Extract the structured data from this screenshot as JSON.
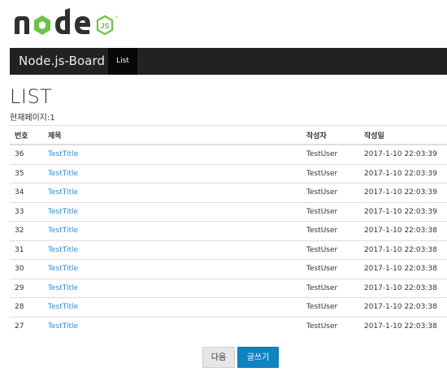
{
  "logo": {
    "text": "node",
    "badge": "JS",
    "label": "node.js"
  },
  "navbar": {
    "brand": "Node.js-Board",
    "items": [
      {
        "label": "List",
        "active": true
      }
    ]
  },
  "page": {
    "title": "LIST",
    "current_page_label": "현재페이지:1"
  },
  "table": {
    "columns": [
      "번호",
      "제목",
      "작성자",
      "작성일"
    ],
    "rows": [
      {
        "num": "36",
        "title": "TestTitle",
        "author": "TestUser",
        "date": "2017-1-10 22:03:39"
      },
      {
        "num": "35",
        "title": "TestTitle",
        "author": "TestUser",
        "date": "2017-1-10 22:03:39"
      },
      {
        "num": "34",
        "title": "TestTitle",
        "author": "TestUser",
        "date": "2017-1-10 22:03:39"
      },
      {
        "num": "33",
        "title": "TestTitle",
        "author": "TestUser",
        "date": "2017-1-10 22:03:39"
      },
      {
        "num": "32",
        "title": "TestTitle",
        "author": "TestUser",
        "date": "2017-1-10 22:03:38"
      },
      {
        "num": "31",
        "title": "TestTitle",
        "author": "TestUser",
        "date": "2017-1-10 22:03:38"
      },
      {
        "num": "30",
        "title": "TestTitle",
        "author": "TestUser",
        "date": "2017-1-10 22:03:38"
      },
      {
        "num": "29",
        "title": "TestTitle",
        "author": "TestUser",
        "date": "2017-1-10 22:03:38"
      },
      {
        "num": "28",
        "title": "TestTitle",
        "author": "TestUser",
        "date": "2017-1-10 22:03:38"
      },
      {
        "num": "27",
        "title": "TestTitle",
        "author": "TestUser",
        "date": "2017-1-10 22:03:38"
      }
    ]
  },
  "buttons": {
    "next": "다음",
    "write": "글쓰기"
  },
  "colors": {
    "navbar": "#222222",
    "link": "#2b8dd1",
    "primary": "#0f83c3",
    "logo_dark": "#303030",
    "logo_green": "#6cc24a"
  }
}
